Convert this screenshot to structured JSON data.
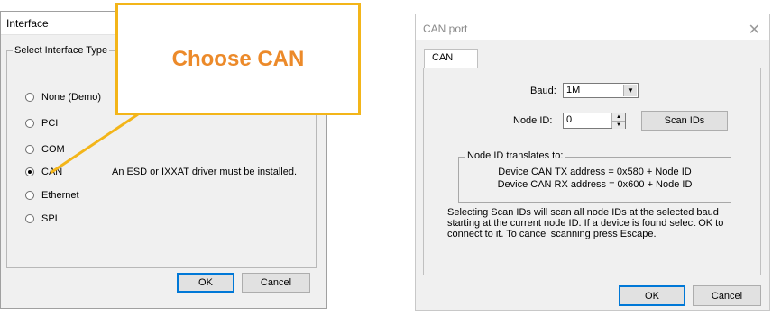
{
  "interface_dialog": {
    "title": "Interface",
    "group_label": "Select Interface Type",
    "options": [
      {
        "label": "None (Demo)",
        "checked": false
      },
      {
        "label": "PCI",
        "checked": false
      },
      {
        "label": "COM",
        "checked": false
      },
      {
        "label": "CAN",
        "checked": true
      },
      {
        "label": "Ethernet",
        "checked": false
      },
      {
        "label": "SPI",
        "checked": false
      }
    ],
    "can_note": "An ESD or IXXAT driver must be installed.",
    "ok_label": "OK",
    "cancel_label": "Cancel"
  },
  "callout": {
    "text": "Choose CAN",
    "border_color": "#f3b519",
    "text_color": "#ec8a2a"
  },
  "can_port_dialog": {
    "title": "CAN port",
    "tab_label": "CAN",
    "baud_label": "Baud:",
    "baud_value": "1M",
    "node_id_label": "Node ID:",
    "node_id_value": "0",
    "scan_ids_label": "Scan IDs",
    "translate_group_label": "Node ID translates to:",
    "tx_line": "Device CAN TX address = 0x580 + Node ID",
    "rx_line": "Device CAN RX address = 0x600 + Node ID",
    "description": "Selecting Scan IDs will scan all node IDs at the selected baud starting at the current node ID. If a device is found select OK to connect to it. To cancel scanning press Escape.",
    "ok_label": "OK",
    "cancel_label": "Cancel"
  }
}
